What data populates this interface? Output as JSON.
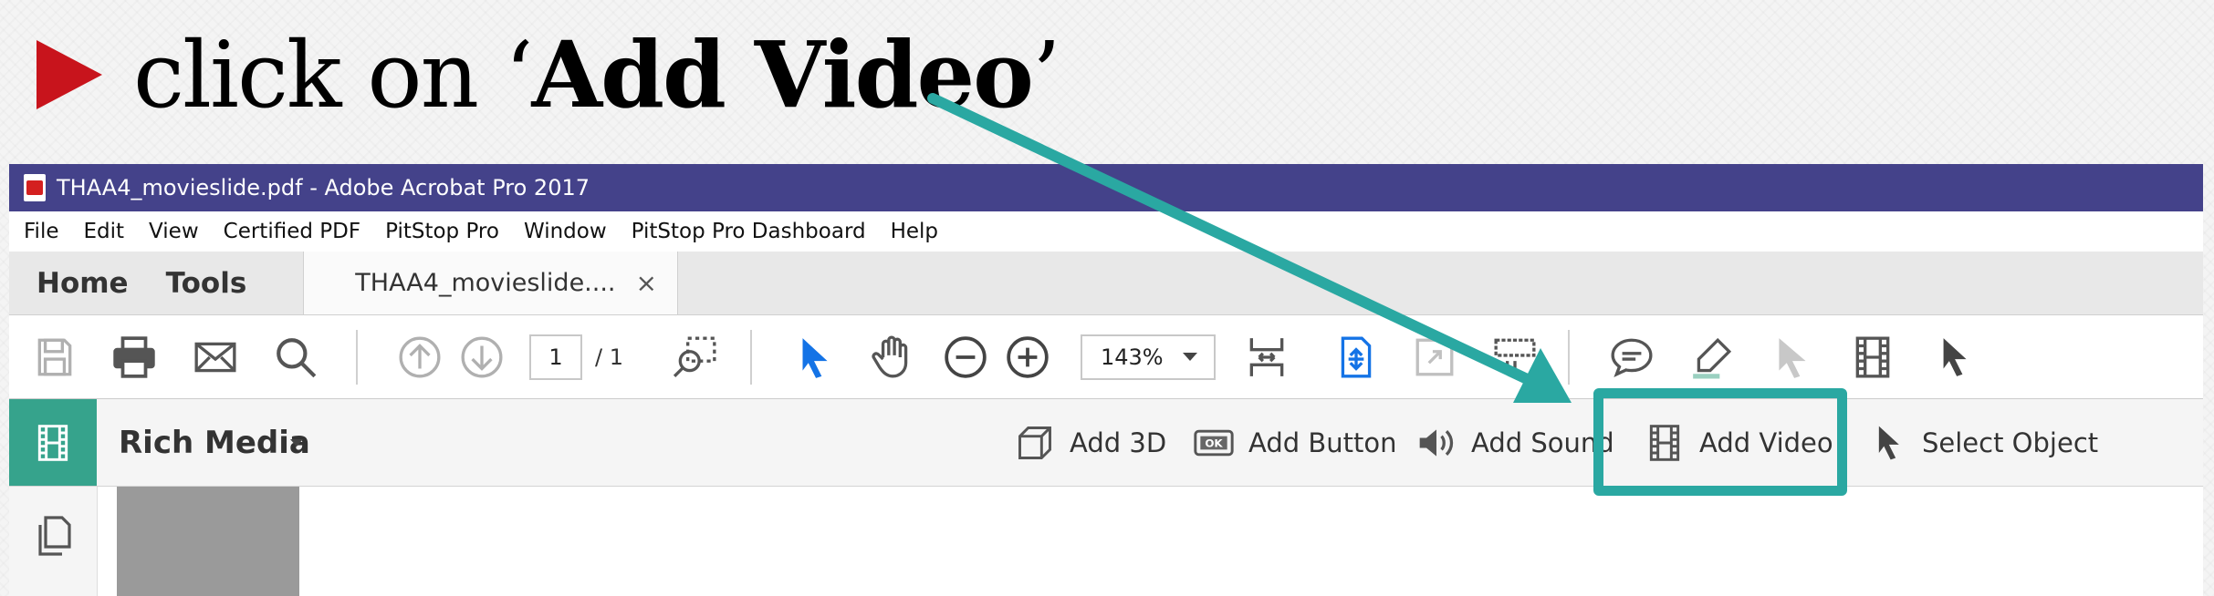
{
  "slide": {
    "instruction_prefix": "click on ‘",
    "instruction_bold": "Add Video",
    "instruction_suffix": "’"
  },
  "window": {
    "title": "THAA4_movieslide.pdf - Adobe Acrobat Pro 2017"
  },
  "menu": [
    "File",
    "Edit",
    "View",
    "Certified PDF",
    "PitStop Pro",
    "Window",
    "PitStop Pro Dashboard",
    "Help"
  ],
  "tabs": {
    "home": "Home",
    "tools": "Tools",
    "document": "THAA4_movieslide....",
    "close": "×"
  },
  "toolbar": {
    "page_current": "1",
    "page_total": "/ 1",
    "zoom": "143%"
  },
  "rich_media": {
    "title": "Rich Media",
    "tools": [
      "Add 3D",
      "Add Button",
      "Add Sound",
      "Add Video",
      "Select Object"
    ],
    "button_icon_text": "OK"
  },
  "colors": {
    "title_bar": "#44428a",
    "bullet": "#c8141c",
    "annotation": "#2aa8a2",
    "rich_media_accent": "#36a38c",
    "tool_blue": "#1473e6"
  },
  "icons": {
    "slide_bullet": "right-triangle-bullet",
    "window": "pdf-file-icon",
    "annotation_arrow": "pointer-arrow"
  }
}
